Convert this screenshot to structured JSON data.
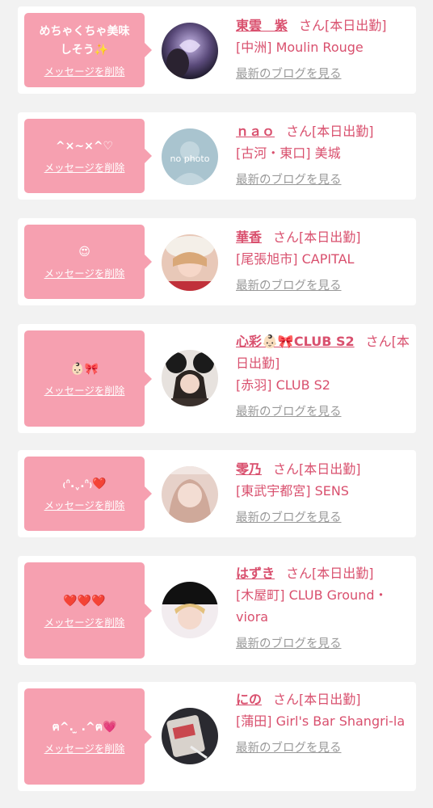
{
  "colors": {
    "accent": "#d9506e",
    "bubble": "#f6a0b0",
    "muted": "#999999",
    "background": "#f2f2f2"
  },
  "delete_label": "メッセージを削除",
  "blog_label": "最新のブログを見る",
  "cards": [
    {
      "message": "めちゃくちゃ美味\nしそう✨",
      "name": "東雲　紫",
      "suffix": "さん[本日出勤]",
      "shop": "[中洲] Moulin Rouge"
    },
    {
      "message": "^×~×^♡",
      "name": "ｎａｏ",
      "suffix": "さん[本日出勤]",
      "shop": "[古河・東口] 美城",
      "avatar_text": "no photo"
    },
    {
      "message": "😍",
      "name": "華香",
      "suffix": "さん[本日出勤]",
      "shop": "[尾張旭市] CAPITAL"
    },
    {
      "message": "👶🏻🎀",
      "name": "心彩👶🏻🎀CLUB S2",
      "suffix": "さん[本日出勤]",
      "shop": "[赤羽] CLUB S2"
    },
    {
      "message": "₍ᐢ.ˬ.ᐢ₎❤️",
      "name": "零乃",
      "suffix": "さん[本日出勤]",
      "shop": "[東武宇都宮] SENS"
    },
    {
      "message": "❤️❤️❤️",
      "name": "はずき",
      "suffix": "さん[本日出勤]",
      "shop": "[木屋町] CLUB Ground・viora"
    },
    {
      "message": "ฅ^. ̫ .^ฅ💗",
      "name": "にの",
      "suffix": "さん[本日出勤]",
      "shop": "[蒲田] Girl's Bar Shangri-la"
    }
  ]
}
